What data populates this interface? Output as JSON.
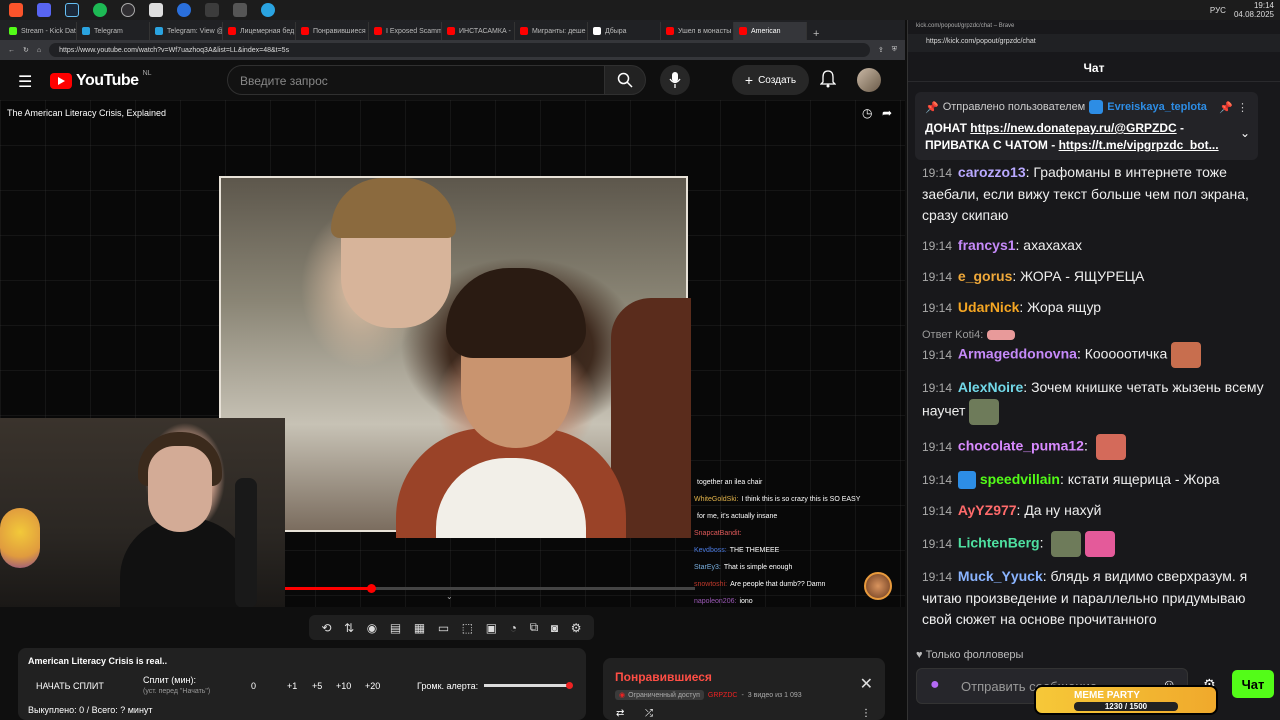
{
  "taskbar": {
    "icons": [
      "brave-icon",
      "discord-icon",
      "steam-icon",
      "spotify-icon",
      "obs-icon",
      "game-icon",
      "app-icon",
      "folder-icon",
      "settings-icon",
      "telegram-icon"
    ],
    "tray": {
      "lang": "РУС",
      "time": "19:14",
      "date": "04.08.2025"
    }
  },
  "browser": {
    "tabs": [
      {
        "label": "Stream - Kick Dat",
        "color": "#53fc18"
      },
      {
        "label": "Telegram",
        "color": "#2aa3e0"
      },
      {
        "label": "Telegram: View @",
        "color": "#2aa3e0"
      },
      {
        "label": "Лицемерная бед",
        "color": "#ff0000"
      },
      {
        "label": "Понравившиеся",
        "color": "#ff0000"
      },
      {
        "label": "I Exposed Scamm",
        "color": "#ff0000"
      },
      {
        "label": "ИНСТАСАМКА -",
        "color": "#ff0000"
      },
      {
        "label": "Мигранты: деше",
        "color": "#ff0000"
      },
      {
        "label": "Дбыра",
        "color": "#ffffff"
      },
      {
        "label": "Ушел в монасты",
        "color": "#ff0000"
      },
      {
        "label": "American",
        "color": "#ff0000"
      }
    ],
    "url": "https://www.youtube.com/watch?v=Wf7uazhoq3A&list=LL&index=48&t=5s"
  },
  "youtube": {
    "logo_text": "YouTube",
    "region": "NL",
    "search_placeholder": "Введите запрос",
    "create_label": "Создать",
    "video_title": "The American Literacy Crisis, Explained",
    "progress": 0.21
  },
  "overlay_chat": [
    {
      "user": "",
      "color": "#fff",
      "text": "together an ilea chair"
    },
    {
      "user": "WhiteGoldSki:",
      "color": "#e0b24a",
      "text": "I think this is so crazy  this is SO EASY"
    },
    {
      "user": "",
      "color": "#fff",
      "text": "for me, it's actually insane"
    },
    {
      "user": "SnapcatBandit:",
      "color": "#e05a5a",
      "text": ""
    },
    {
      "user": "Kevdboss:",
      "color": "#4a7ae0",
      "text": "THE THEMEEE"
    },
    {
      "user": "StarEy3:",
      "color": "#7ab0e0",
      "text": "That is simple enough"
    },
    {
      "user": "snowtoshi:",
      "color": "#c0392b",
      "text": "Are people that dumb?? Damn"
    },
    {
      "user": "napoleon206:",
      "color": "#9b59b6",
      "text": "iono"
    }
  ],
  "tools": [
    "repeat-icon",
    "sort-icon",
    "audio-icon",
    "playlist-icon",
    "clapper-icon",
    "theater-icon",
    "crop-icon",
    "screen-icon",
    "speed-icon",
    "pip-icon",
    "camera-icon",
    "gear-icon"
  ],
  "split": {
    "title": "American Literacy Crisis is real..",
    "start_label": "НАЧАТЬ СПЛИТ",
    "split_label": "Сплит (мин):",
    "split_sub": "(уст. перед \"Начать\")",
    "value": "0",
    "increments": [
      "+1",
      "+5",
      "+10",
      "+20"
    ],
    "volume_label": "Громк. алерта:",
    "volume": 0.96,
    "status": "Выкуплено: 0 / Всего: ? минут"
  },
  "liked": {
    "title": "Понравившиеся",
    "access": "Ограниченный доступ",
    "owner": "GRPZDC",
    "count": "3 видео из 1 093"
  },
  "kick": {
    "window_title": "kick.com/popout/grpzdc/chat – Brave",
    "url": "https://kick.com/popout/grpzdc/chat",
    "header": "Чат",
    "pinned": {
      "by_label": "Отправлено пользователем",
      "by_user": "Evreiskaya_teplota",
      "line1": "ДОНАТ ",
      "link1": "https://new.donatepay.ru/@GRPZDC",
      "line1_end": " -",
      "line2": "ПРИВАТКА С ЧАТОМ - ",
      "link2": "https://t.me/vipgrpzdc_bot..."
    },
    "messages": [
      {
        "time": "19:14",
        "user": "carozzo13",
        "color": "#b9a9ff",
        "text": "Графоманы в интернете тоже заебали, если вижу текст больше чем пол экрана, сразу скипаю"
      },
      {
        "time": "19:14",
        "user": "francys1",
        "color": "#c58af9",
        "text": "ахахахах"
      },
      {
        "time": "19:14",
        "user": "e_gorus",
        "color": "#f0a93a",
        "text": "ЖОРА - ЯЩУРЕЦА"
      },
      {
        "time": "19:14",
        "user": "UdarNick",
        "color": "#f5a623",
        "text": "Жора ящур"
      },
      {
        "time": "19:14",
        "user": "Armageddonovna",
        "color": "#c58af9",
        "text": "Кооооотичка",
        "reply": "Ответ Koti4:"
      },
      {
        "time": "19:14",
        "user": "AlexNoire",
        "color": "#72d8e8",
        "text": "Зочем книшке четать жызень всему научет"
      },
      {
        "time": "19:14",
        "user": "chocolate_puma12",
        "color": "#d88aff",
        "text": ""
      },
      {
        "time": "19:14",
        "user": "speedvillain",
        "color": "#53fc18",
        "text": "кстати ящерица - Жора"
      },
      {
        "time": "19:14",
        "user": "AyYZ977",
        "color": "#ff6b6b",
        "text": "Да ну нахуй"
      },
      {
        "time": "19:14",
        "user": "LichtenBerg",
        "color": "#4ee0a0",
        "text": ""
      },
      {
        "time": "19:14",
        "user": "Muck_Yyuck",
        "color": "#8ab4ff",
        "text": "блядь я видимо сверхразум. я читаю произведение и параллельно придумываю свой сюжет на основе прочитанного"
      }
    ],
    "followers_label": "Только фолловеры",
    "input_placeholder": "Отправить сообщение",
    "send_label": "Чат",
    "meme_party": {
      "title": "MEME PARTY",
      "progress": "1230 / 1500"
    }
  }
}
